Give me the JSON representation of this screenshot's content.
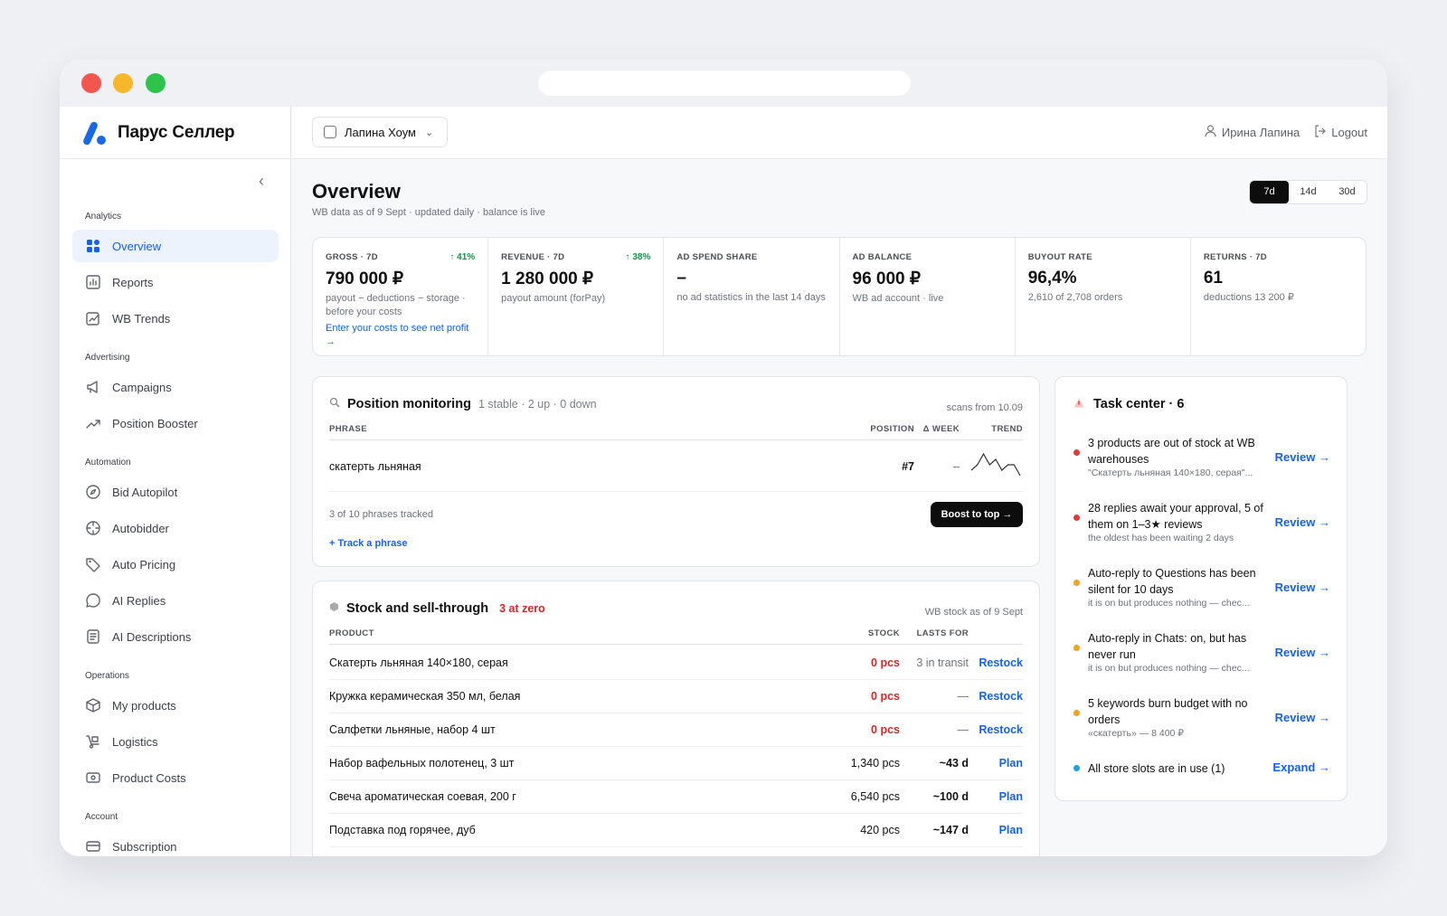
{
  "brand": {
    "name": "Парус Селлер"
  },
  "colors": {
    "accent": "#1562e6",
    "danger": "#d42727",
    "success": "#17914a",
    "warning": "#f1a51f",
    "info": "#1ea0e8"
  },
  "sidebar": {
    "groups": [
      {
        "label": "Analytics",
        "items": [
          {
            "label": "Overview",
            "icon": "grid-icon",
            "active": true
          },
          {
            "label": "Reports",
            "icon": "bar-chart-icon"
          },
          {
            "label": "WB Trends",
            "icon": "trend-card-icon"
          }
        ]
      },
      {
        "label": "Advertising",
        "items": [
          {
            "label": "Campaigns",
            "icon": "megaphone-icon"
          },
          {
            "label": "Position Booster",
            "icon": "trending-up-icon"
          }
        ]
      },
      {
        "label": "Automation",
        "items": [
          {
            "label": "Bid Autopilot",
            "icon": "compass-icon"
          },
          {
            "label": "Autobidder",
            "icon": "target-icon"
          },
          {
            "label": "Auto Pricing",
            "icon": "tag-icon"
          },
          {
            "label": "AI Replies",
            "icon": "chat-bubble-icon"
          },
          {
            "label": "AI Descriptions",
            "icon": "document-icon"
          }
        ]
      },
      {
        "label": "Operations",
        "items": [
          {
            "label": "My products",
            "icon": "box-icon"
          },
          {
            "label": "Logistics",
            "icon": "dolly-icon"
          },
          {
            "label": "Product Costs",
            "icon": "cash-icon"
          }
        ]
      },
      {
        "label": "Account",
        "items": [
          {
            "label": "Subscription",
            "icon": "credit-card-icon"
          }
        ]
      }
    ]
  },
  "topbar": {
    "store": "Лапина Хоум",
    "user": "Ирина Лапина",
    "logout": "Logout"
  },
  "page": {
    "title": "Overview",
    "subtitle": "WB data as of 9 Sept · updated daily · balance is live",
    "ranges": [
      "7d",
      "14d",
      "30d"
    ],
    "selected_range": "7d"
  },
  "kpis": [
    {
      "label": "GROSS · 7D",
      "delta": "↑ 41%",
      "value": "790 000 ₽",
      "note": "payout − deductions − storage · before your costs",
      "link": "Enter your costs to see net profit →"
    },
    {
      "label": "REVENUE · 7D",
      "delta": "↑ 38%",
      "value": "1 280 000 ₽",
      "note": "payout amount (forPay)"
    },
    {
      "label": "AD SPEND SHARE",
      "value": "–",
      "note": "no ad statistics in the last 14 days"
    },
    {
      "label": "AD BALANCE",
      "value": "96 000 ₽",
      "note": "WB ad account · live"
    },
    {
      "label": "BUYOUT RATE",
      "value": "96,4%",
      "note": "2,610 of 2,708 orders"
    },
    {
      "label": "RETURNS · 7D",
      "value": "61",
      "note": "deductions 13 200 ₽"
    }
  ],
  "position_monitoring": {
    "title": "Position monitoring",
    "meta": "1 stable · 2 up · 0 down",
    "scans": "scans from 10.09",
    "columns": [
      "PHRASE",
      "POSITION",
      "Δ WEEK",
      "TREND"
    ],
    "rows": [
      {
        "phrase": "скатерть льняная",
        "position": "#7",
        "delta": "–",
        "trend": [
          4,
          3,
          1,
          3,
          2,
          4,
          3,
          3,
          5
        ]
      }
    ],
    "tracked": "3 of 10 phrases tracked",
    "boost": "Boost to top →",
    "add": "+ Track a phrase"
  },
  "stock": {
    "title": "Stock and sell-through",
    "alert": "3 at zero",
    "as_of": "WB stock as of 9 Sept",
    "columns": [
      "PRODUCT",
      "STOCK",
      "LASTS FOR"
    ],
    "rows": [
      {
        "product": "Скатерть льняная 140×180, серая",
        "stock": "0 pcs",
        "zero": true,
        "lasts": "3 in transit",
        "action": "Restock"
      },
      {
        "product": "Кружка керамическая 350 мл, белая",
        "stock": "0 pcs",
        "zero": true,
        "lasts": "—",
        "action": "Restock"
      },
      {
        "product": "Салфетки льняные, набор 4 шт",
        "stock": "0 pcs",
        "zero": true,
        "lasts": "—",
        "action": "Restock"
      },
      {
        "product": "Набор вафельных полотенец, 3 шт",
        "stock": "1,340 pcs",
        "zero": false,
        "lasts": "~43 d",
        "action": "Plan"
      },
      {
        "product": "Свеча ароматическая соевая, 200 г",
        "stock": "6,540 pcs",
        "zero": false,
        "lasts": "~100 d",
        "action": "Plan"
      },
      {
        "product": "Подставка под горячее, дуб",
        "stock": "420 pcs",
        "zero": false,
        "lasts": "~147 d",
        "action": "Plan"
      }
    ]
  },
  "tasks": {
    "title": "Task center · 6",
    "items": [
      {
        "title": "3 products are out of stock at WB warehouses",
        "sub": "\"Скатерть льняная 140×180, серая\"...",
        "action": "Review →",
        "color": "#e53838"
      },
      {
        "title": "28 replies await your approval, 5 of them on 1–3★ reviews",
        "sub": "the oldest has been waiting 2 days",
        "action": "Review →",
        "color": "#e53838"
      },
      {
        "title": "Auto-reply to Questions has been silent for 10 days",
        "sub": "it is on but produces nothing — chec...",
        "action": "Review →",
        "color": "#f1a51f"
      },
      {
        "title": "Auto-reply in Chats: on, but has never run",
        "sub": "it is on but produces nothing — chec...",
        "action": "Review →",
        "color": "#f1a51f"
      },
      {
        "title": "5 keywords burn budget with no orders",
        "sub": "«скатерть» — 8 400 ₽",
        "action": "Review →",
        "color": "#f1a51f"
      },
      {
        "title": "All store slots are in use (1)",
        "sub": "",
        "action": "Expand →",
        "color": "#1ea0e8"
      }
    ]
  }
}
